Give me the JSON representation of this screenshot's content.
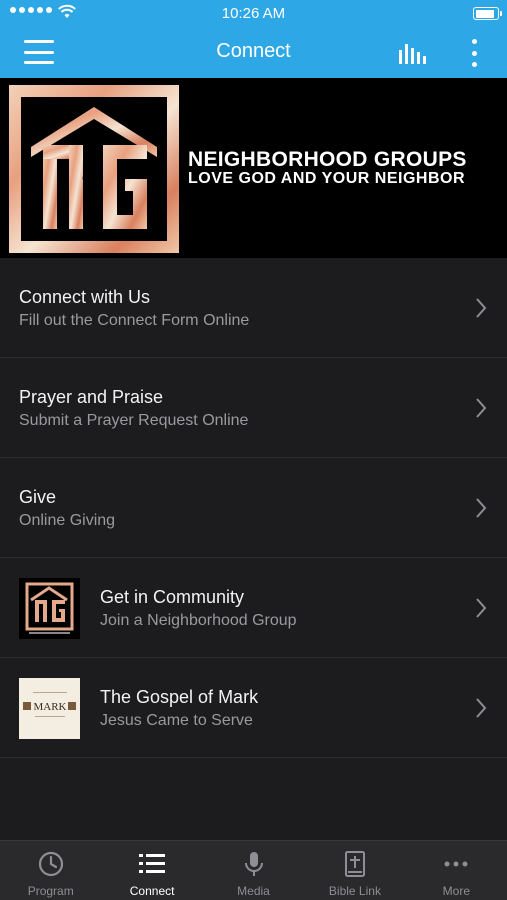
{
  "status_bar": {
    "time": "10:26 AM"
  },
  "nav": {
    "title": "Connect"
  },
  "banner": {
    "title": "NEIGHBORHOOD GROUPS",
    "subtitle": "LOVE GOD AND YOUR NEIGHBOR",
    "logo_text": "NG"
  },
  "items": [
    {
      "title": "Connect with Us",
      "subtitle": "Fill out the Connect Form Online"
    },
    {
      "title": "Prayer and Praise",
      "subtitle": "Submit a Prayer Request Online"
    },
    {
      "title": "Give",
      "subtitle": "Online Giving"
    },
    {
      "title": "Get in Community",
      "subtitle": "Join a Neighborhood Group",
      "thumb": "neighborhood-groups-logo"
    },
    {
      "title": "The Gospel of Mark",
      "subtitle": "Jesus Came to Serve",
      "thumb": "gospel-of-mark-cover",
      "thumb_text": "MARK"
    }
  ],
  "tabs": [
    {
      "label": "Program",
      "icon": "clock-icon",
      "active": false
    },
    {
      "label": "Connect",
      "icon": "list-icon",
      "active": true
    },
    {
      "label": "Media",
      "icon": "microphone-icon",
      "active": false
    },
    {
      "label": "Bible Link",
      "icon": "bible-icon",
      "active": false
    },
    {
      "label": "More",
      "icon": "more-dots-icon",
      "active": false
    }
  ],
  "colors": {
    "accent": "#2ea7e6",
    "background": "#1c1c1e",
    "tab_bar": "#2a2a2c"
  }
}
